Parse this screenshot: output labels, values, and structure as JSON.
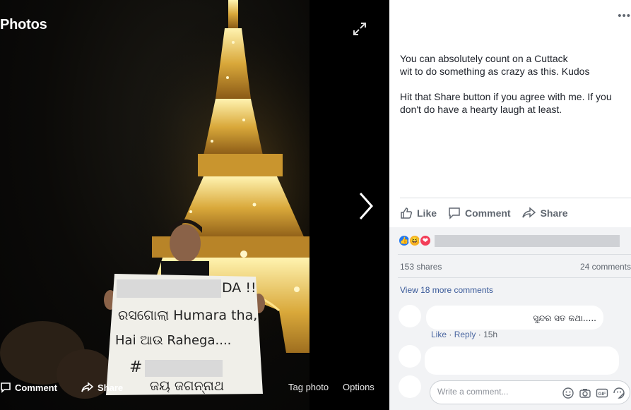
{
  "viewer": {
    "title": "Photos",
    "actions": {
      "comment": "Comment",
      "share": "Share",
      "tag_photo": "Tag photo",
      "options": "Options"
    },
    "placard": {
      "line1_tail": "DA !!",
      "line2": "ରସଗୋଲା Humara tha,",
      "line3": "Hai ଆଉ Rahega....",
      "line4": "#",
      "line5": "ଜୟ ଜଗନ୍ନାଥ"
    }
  },
  "post": {
    "caption": [
      "You can absolutely count on a Cuttack\nwit to do something as crazy as this. Kudos",
      "Hit that Share button if you agree with me. If you\ndon't do have a hearty laugh at least."
    ],
    "actions": {
      "like": "Like",
      "comment": "Comment",
      "share": "Share"
    },
    "reactions": [
      "like",
      "haha",
      "love"
    ],
    "shares": "153 shares",
    "comments_count": "24 comments",
    "view_more": "View 18 more comments",
    "comments": [
      {
        "text": "ସୁନ୍ଦର ସତ କଥା.....",
        "like": "Like",
        "reply": "Reply",
        "time": "15h"
      }
    ],
    "composer_placeholder": "Write a comment..."
  },
  "colors": {
    "link": "#385898",
    "meta": "#606770",
    "like_reaction": "#2078f4",
    "haha_reaction": "#f7b125",
    "love_reaction": "#f33e58"
  }
}
